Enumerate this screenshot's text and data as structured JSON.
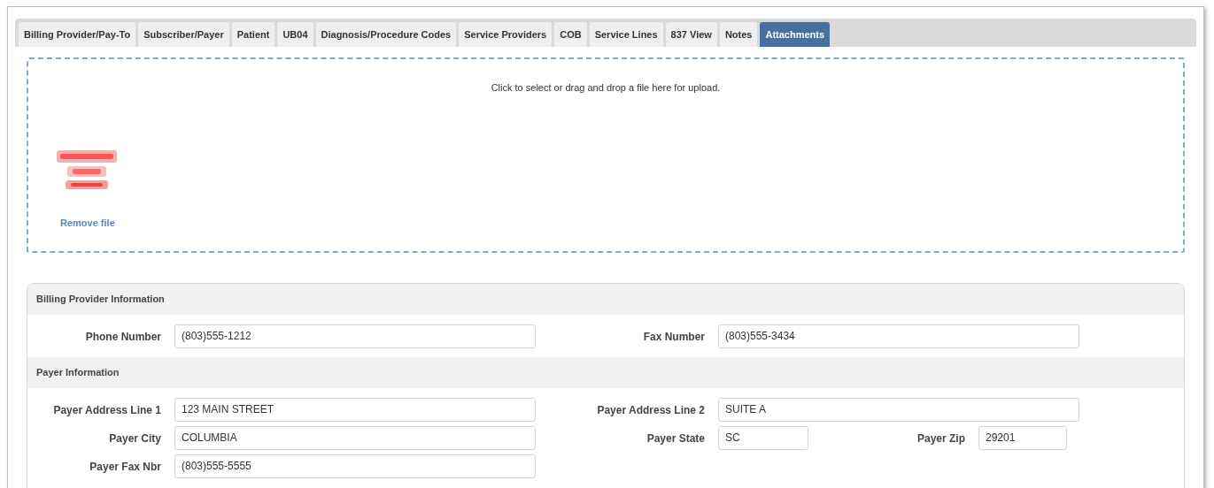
{
  "tabs": [
    {
      "label": "Billing Provider/Pay-To",
      "selected": false
    },
    {
      "label": "Subscriber/Payer",
      "selected": false
    },
    {
      "label": "Patient",
      "selected": false
    },
    {
      "label": "UB04",
      "selected": false
    },
    {
      "label": "Diagnosis/Procedure Codes",
      "selected": false
    },
    {
      "label": "Service Providers",
      "selected": false
    },
    {
      "label": "COB",
      "selected": false
    },
    {
      "label": "Service Lines",
      "selected": false
    },
    {
      "label": "837 View",
      "selected": false
    },
    {
      "label": "Notes",
      "selected": false
    },
    {
      "label": "Attachments",
      "selected": true
    }
  ],
  "dropzone": {
    "prompt": "Click to select or drag and drop a file here for upload.",
    "file": {
      "kind": "picture",
      "remove_link": "Remove file"
    }
  },
  "sections": [
    {
      "title": "Billing Provider Information",
      "rows": [
        {
          "left": [
            {
              "label": "Phone Number",
              "value": "(803)555-1212",
              "kind": "wide"
            }
          ],
          "right": [
            {
              "label": "Fax Number",
              "value": "(803)555-3434",
              "kind": "wide"
            }
          ]
        }
      ]
    },
    {
      "title": "Payer Information",
      "rows": [
        {
          "left": [
            {
              "label": "Payer Address Line 1",
              "value": "123 MAIN STREET",
              "kind": "wide"
            }
          ],
          "right": [
            {
              "label": "Payer Address Line 2",
              "value": "SUITE A",
              "kind": "wide"
            }
          ]
        },
        {
          "left": [
            {
              "label": "Payer City",
              "value": "COLUMBIA",
              "kind": "wide"
            }
          ],
          "right": [
            {
              "label": "Payer State",
              "value": "SC",
              "kind": "short"
            },
            {
              "label": "Payer Zip",
              "value": "29201",
              "kind": "short"
            }
          ]
        },
        {
          "left": [
            {
              "label": "Payer Fax Nbr",
              "value": "(803)555-5555",
              "kind": "wide"
            }
          ],
          "right": []
        }
      ]
    }
  ]
}
